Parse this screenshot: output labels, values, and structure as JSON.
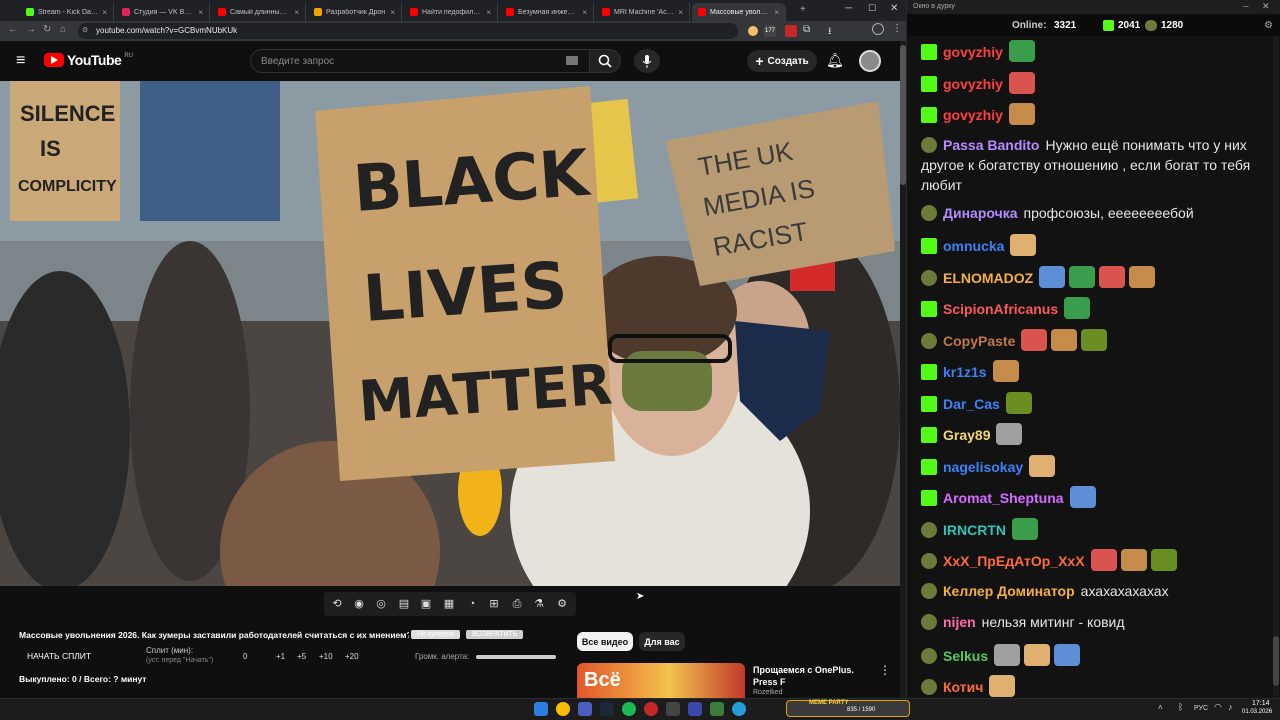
{
  "browser": {
    "tabs": [
      {
        "title": "Stream - Kick Dashboard",
        "color": "#53fc18"
      },
      {
        "title": "Студия — VK Видео Live",
        "color": "#e0245e"
      },
      {
        "title": "Самый длинный нос",
        "color": "#ff0000"
      },
      {
        "title": "Разработчик Дрон",
        "color": "#f4a300"
      },
      {
        "title": "Найти педофила по",
        "color": "#ff0000"
      },
      {
        "title": "Безумная инженерия",
        "color": "#ff0000"
      },
      {
        "title": "MRI Machine 'Accident'",
        "color": "#ff0000"
      },
      {
        "title": "Массовые увольнения",
        "color": "#ff0000"
      }
    ],
    "url": "youtube.com/watch?v=GCBvmNUbKUk",
    "ext_badge": "177"
  },
  "youtube": {
    "logo": "YouTube",
    "region": "RU",
    "search_placeholder": "Введите запрос",
    "create_label": "Создать"
  },
  "video": {
    "sign_main": "BLACK LIVES MATTER",
    "sign_left": "SILENCE IS COMPLICITY",
    "sign_right": "THE UK MEDIA IS RACIST"
  },
  "panel": {
    "video_title": "Массовые увольнения 2026. Как зумеры заставили работодателей считаться с их мнением?",
    "btn_not_buy": "Не куплено",
    "btn_return": "ВОЗВРАТИТЬ",
    "start_split": "НАЧАТЬ СПЛИТ",
    "split_label": "Сплит (мин):",
    "split_hint": "(уст. перед \"Начать\")",
    "split_values": [
      "0",
      "+1",
      "+5",
      "+10",
      "+20"
    ],
    "alert_volume": "Громк. алерта:",
    "bought": "Выкуплено: 0 / Всего: ? минут",
    "filter_all": "Все видео",
    "filter_you": "Для вас",
    "rec_title": "Прощаемся с OnePlus. Press F",
    "rec_channel": "Rozetked",
    "rec_thumb_text": "Всё"
  },
  "chat": {
    "window_title": "Окно в дурку",
    "online_label": "Online:",
    "online_count": "3321",
    "kick_count": "2041",
    "other_count": "1280",
    "messages": [
      {
        "badge": "kick",
        "user": "govyzhiy",
        "color": "#ff4040",
        "text": "",
        "emotes": 1
      },
      {
        "badge": "kick",
        "user": "govyzhiy",
        "color": "#ff4040",
        "text": "",
        "emotes": 1
      },
      {
        "badge": "kick",
        "user": "govyzhiy",
        "color": "#ff4040",
        "text": "",
        "emotes": 1
      },
      {
        "badge": "vk",
        "user": "Passa Bandito",
        "color": "#b38cff",
        "text": "Нужно ещё понимать что у них другое к богатству отношению , если богат то тебя любит",
        "emotes": 0
      },
      {
        "badge": "vk",
        "user": "Динарочка",
        "color": "#b38cff",
        "text": "профсоюзы, еееееееебой",
        "emotes": 0
      },
      {
        "badge": "kick",
        "user": "omnucka",
        "color": "#3b82f6",
        "text": "",
        "emotes": 1
      },
      {
        "badge": "vk",
        "user": "ELNOMADOZ",
        "color": "#f5b041",
        "text": "",
        "emotes": 4
      },
      {
        "badge": "kick",
        "user": "ScipionAfricanus",
        "color": "#ff5a5a",
        "text": "",
        "emotes": 1
      },
      {
        "badge": "vk",
        "user": "CopyPaste",
        "color": "#c0774a",
        "text": "",
        "emotes": 3
      },
      {
        "badge": "kick",
        "user": "kr1z1s",
        "color": "#3b82f6",
        "text": "",
        "emotes": 1
      },
      {
        "badge": "kick",
        "user": "Dar_Cas",
        "color": "#3b82f6",
        "text": "",
        "emotes": 1
      },
      {
        "badge": "kick",
        "user": "Gray89",
        "color": "#f5d76e",
        "text": "",
        "emotes": 1
      },
      {
        "badge": "kick",
        "user": "nagelisokay",
        "color": "#3b82f6",
        "text": "",
        "emotes": 1
      },
      {
        "badge": "kick",
        "user": "Aromat_Sheptuna",
        "color": "#d66bff",
        "text": "",
        "emotes": 1
      },
      {
        "badge": "vk",
        "user": "IRNCRTN",
        "color": "#2ec4b6",
        "text": "",
        "emotes": 1
      },
      {
        "badge": "vk",
        "user": "XxX_ПрЕдАтОр_XxX",
        "color": "#ff6b3d",
        "text": "",
        "emotes": 3
      },
      {
        "badge": "vk",
        "user": "Келлер Доминатор",
        "color": "#f5b041",
        "text": "ахахахахахах",
        "emotes": 0
      },
      {
        "badge": "vk",
        "user": "nijen",
        "color": "#ff6ba8",
        "text": "нельзя митинг - ковид",
        "emotes": 0
      },
      {
        "badge": "vk",
        "user": "Selkus",
        "color": "#5bc85b",
        "text": "",
        "emotes": 3
      },
      {
        "badge": "vk",
        "user": "Котич",
        "color": "#ff6b3d",
        "text": "",
        "emotes": 1
      }
    ]
  },
  "taskbar": {
    "lang": "РУС",
    "time": "17:14",
    "date": "01.03.2026",
    "widget_title": "MEME PARTY",
    "widget_value": "835 / 1590"
  }
}
